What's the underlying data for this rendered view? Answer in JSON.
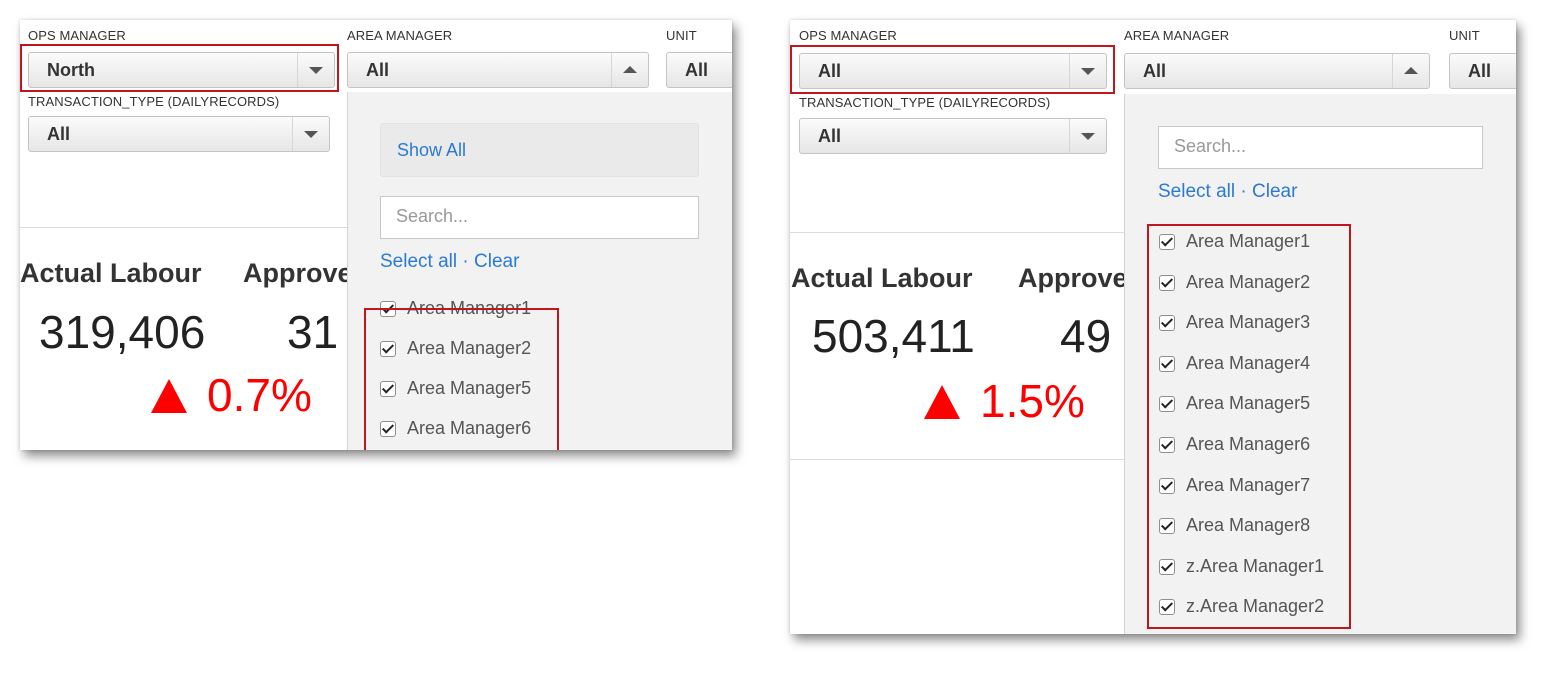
{
  "left": {
    "ops_label": "OPS MANAGER",
    "ops_value": "North",
    "area_label": "AREA MANAGER",
    "area_value": "All",
    "unit_label": "UNIT",
    "unit_value": "All",
    "trans_label": "TRANSACTION_TYPE (DAILYRECORDS)",
    "trans_value": "All",
    "kpi1_title": "Actual Labour",
    "kpi1_value": "319,406",
    "kpi1_delta": "0.7%",
    "kpi2_title": "Approve",
    "kpi2_value": "31",
    "menu": {
      "show_all": "Show All",
      "search_placeholder": "Search...",
      "select_all": "Select all",
      "link_sep": "·",
      "clear": "Clear",
      "items": [
        "Area Manager1",
        "Area Manager2",
        "Area Manager5",
        "Area Manager6"
      ]
    }
  },
  "right": {
    "ops_label": "OPS MANAGER",
    "ops_value": "All",
    "area_label": "AREA MANAGER",
    "area_value": "All",
    "unit_label": "UNIT",
    "unit_value": "All",
    "trans_label": "TRANSACTION_TYPE (DAILYRECORDS)",
    "trans_value": "All",
    "kpi1_title": "Actual Labour",
    "kpi1_value": "503,411",
    "kpi1_delta": "1.5%",
    "kpi2_title": "Approve",
    "kpi2_value": "49",
    "menu": {
      "search_placeholder": "Search...",
      "select_all": "Select all",
      "link_sep": "·",
      "clear": "Clear",
      "items": [
        "Area Manager1",
        "Area Manager2",
        "Area Manager3",
        "Area Manager4",
        "Area Manager5",
        "Area Manager6",
        "Area Manager7",
        "Area Manager8",
        "z.Area Manager1",
        "z.Area Manager2"
      ]
    }
  },
  "colors": {
    "highlight": "#c0161d",
    "delta_up": "#ff0000",
    "link": "#2a7ad5"
  },
  "icons": [
    "caret-down-icon",
    "caret-up-icon",
    "checkbox-checked-icon",
    "up-triangle-icon"
  ]
}
